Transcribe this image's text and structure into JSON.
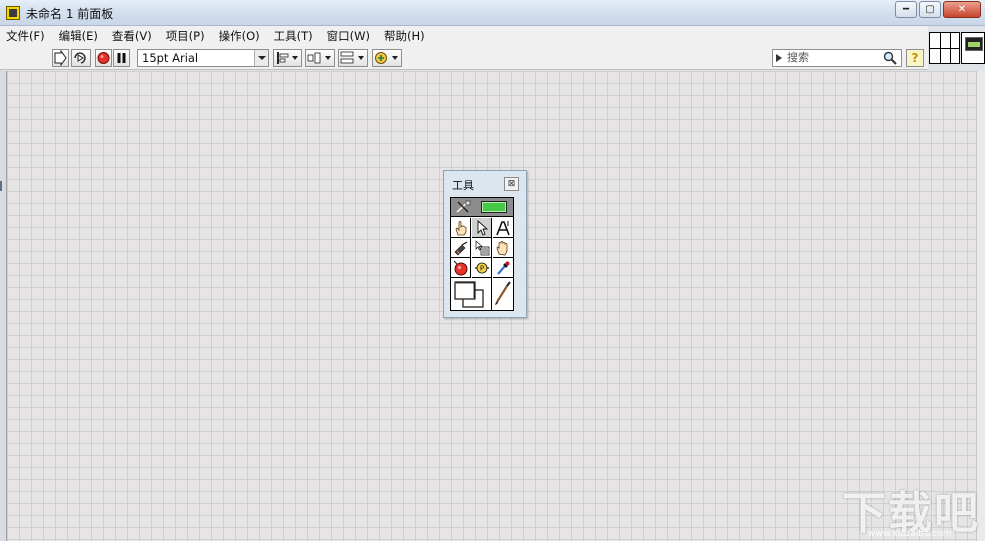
{
  "window": {
    "title": "未命名 1 前面板",
    "minimize_label": "━",
    "maximize_label": "▢",
    "close_label": "✕"
  },
  "menu": {
    "items": [
      "文件(F)",
      "编辑(E)",
      "查看(V)",
      "项目(P)",
      "操作(O)",
      "工具(T)",
      "窗口(W)",
      "帮助(H)"
    ]
  },
  "toolbar": {
    "font_selector_value": "15pt Arial",
    "search_placeholder": "搜索",
    "help_label": "?",
    "buttons": [
      "run-icon",
      "run-continuously-icon",
      "abort-icon",
      "pause-icon",
      "align-objects-icon",
      "distribute-objects-icon",
      "resize-objects-icon",
      "reorder-icon"
    ]
  },
  "tools_palette": {
    "title": "工具",
    "close_label": "⊠",
    "tools": [
      "automatic-tool-selection",
      "operate-value-tool",
      "position-size-select-tool",
      "edit-text-tool",
      "connect-wire-tool",
      "object-shortcut-menu-tool",
      "scroll-window-tool",
      "set-clear-breakpoint-tool",
      "probe-data-tool",
      "get-color-tool",
      "set-color-tool",
      "brush-tool"
    ],
    "selected_tool": "position-size-select-tool"
  },
  "watermark": {
    "text": "下载吧",
    "subtext": "www.xiazaiba.com"
  }
}
